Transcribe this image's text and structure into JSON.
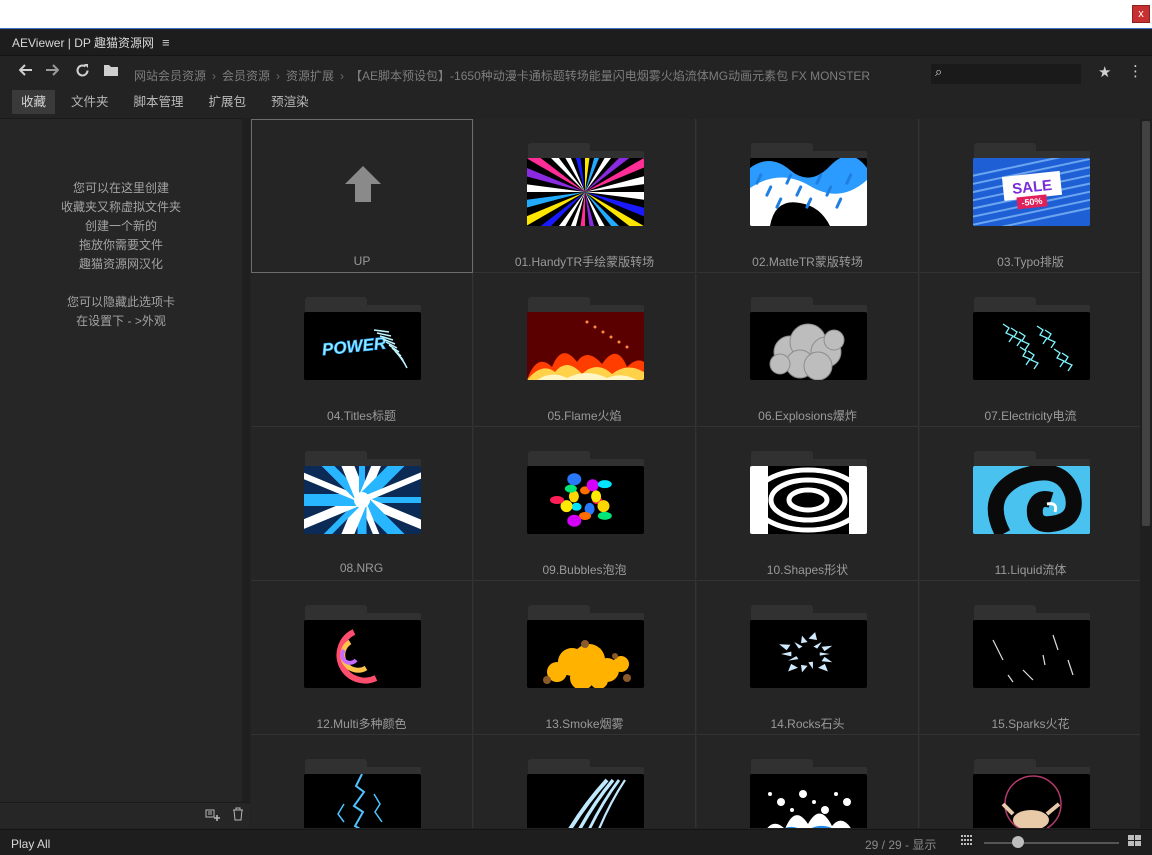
{
  "os": {
    "close_label": "x"
  },
  "panel": {
    "title": "AEViewer | DP 趣猫资源网",
    "menu_icon": "hamburger-menu-icon"
  },
  "nav": {
    "breadcrumb": [
      "网站会员资源",
      "会员资源",
      "资源扩展",
      "【AE脚本预设包】-1650种动漫卡通标题转场能量闪电烟雾火焰流体MG动画元素包 FX MONSTER"
    ],
    "search_placeholder": ""
  },
  "tabs": [
    {
      "label": "收藏",
      "active": true
    },
    {
      "label": "文件夹",
      "active": false
    },
    {
      "label": "脚本管理",
      "active": false
    },
    {
      "label": "扩展包",
      "active": false
    },
    {
      "label": "预渲染",
      "active": false
    }
  ],
  "sidebar": {
    "message_lines": [
      "您可以在这里创建",
      "收藏夹又称虚拟文件夹",
      "创建一个新的",
      "拖放你需要文件",
      "趣猫资源网汉化",
      "",
      "您可以隐藏此选项卡",
      "在设置下 - >外观"
    ]
  },
  "grid": {
    "up_label": "UP",
    "items": [
      {
        "label": "01.HandyTR手绘蒙版转场",
        "thumb": "burst"
      },
      {
        "label": "02.MatteTR蒙版转场",
        "thumb": "wave"
      },
      {
        "label": "03.Typo排版",
        "thumb": "sale"
      },
      {
        "label": "04.Titles标题",
        "thumb": "title"
      },
      {
        "label": "05.Flame火焰",
        "thumb": "flame"
      },
      {
        "label": "06.Explosions爆炸",
        "thumb": "smoke-cloud"
      },
      {
        "label": "07.Electricity电流",
        "thumb": "electric"
      },
      {
        "label": "08.NRG",
        "thumb": "nrg"
      },
      {
        "label": "09.Bubbles泡泡",
        "thumb": "bubbles"
      },
      {
        "label": "10.Shapes形状",
        "thumb": "shapes"
      },
      {
        "label": "11.Liquid流体",
        "thumb": "liquid"
      },
      {
        "label": "12.Multi多种颜色",
        "thumb": "multi"
      },
      {
        "label": "13.Smoke烟雾",
        "thumb": "smoke"
      },
      {
        "label": "14.Rocks石头",
        "thumb": "rocks"
      },
      {
        "label": "15.Sparks火花",
        "thumb": "sparks"
      },
      {
        "label": "",
        "thumb": "lightning"
      },
      {
        "label": "",
        "thumb": "slash"
      },
      {
        "label": "",
        "thumb": "splash"
      },
      {
        "label": "",
        "thumb": "character"
      }
    ],
    "thumb_sale_text": "SALE",
    "thumb_sale_sub": "-50%",
    "thumb_title_text": "POWER"
  },
  "footer": {
    "play_all": "Play All",
    "count": "29 / 29 - 显示",
    "zoom_fraction": 0.25
  }
}
